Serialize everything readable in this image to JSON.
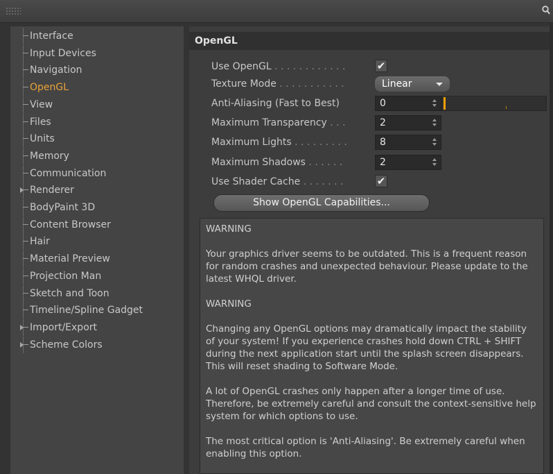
{
  "sidebar": {
    "items": [
      {
        "label": "Interface",
        "active": false,
        "expandable": false
      },
      {
        "label": "Input Devices",
        "active": false,
        "expandable": false
      },
      {
        "label": "Navigation",
        "active": false,
        "expandable": false
      },
      {
        "label": "OpenGL",
        "active": true,
        "expandable": false
      },
      {
        "label": "View",
        "active": false,
        "expandable": false
      },
      {
        "label": "Files",
        "active": false,
        "expandable": false
      },
      {
        "label": "Units",
        "active": false,
        "expandable": false
      },
      {
        "label": "Memory",
        "active": false,
        "expandable": false
      },
      {
        "label": "Communication",
        "active": false,
        "expandable": false
      },
      {
        "label": "Renderer",
        "active": false,
        "expandable": true
      },
      {
        "label": "BodyPaint 3D",
        "active": false,
        "expandable": false
      },
      {
        "label": "Content Browser",
        "active": false,
        "expandable": false
      },
      {
        "label": "Hair",
        "active": false,
        "expandable": false
      },
      {
        "label": "Material Preview",
        "active": false,
        "expandable": false
      },
      {
        "label": "Projection Man",
        "active": false,
        "expandable": false
      },
      {
        "label": "Sketch and Toon",
        "active": false,
        "expandable": false
      },
      {
        "label": "Timeline/Spline Gadget",
        "active": false,
        "expandable": false
      },
      {
        "label": "Import/Export",
        "active": false,
        "expandable": true
      },
      {
        "label": "Scheme Colors",
        "active": false,
        "expandable": true
      }
    ]
  },
  "panel": {
    "title": "OpenGL",
    "use_opengl": {
      "label": "Use OpenGL",
      "dots": " . . . . . . . . . . . .",
      "checked": true,
      "mark": "✔"
    },
    "texture_mode": {
      "label": "Texture Mode",
      "dots": " . . . . . . . . . . .",
      "value": "Linear"
    },
    "anti_aliasing": {
      "label": "Anti-Aliasing (Fast to Best)",
      "value": "0"
    },
    "max_transparency": {
      "label": "Maximum Transparency",
      "dots": " . . .",
      "value": "2"
    },
    "max_lights": {
      "label": "Maximum Lights",
      "dots": " . . . . . . . . .",
      "value": "8"
    },
    "max_shadows": {
      "label": "Maximum Shadows",
      "dots": " . . . . . .",
      "value": "2"
    },
    "shader_cache": {
      "label": "Use Shader Cache",
      "dots": " . . . . . . .",
      "checked": true,
      "mark": "✔"
    },
    "caps_button": "Show OpenGL Capabilities...",
    "warning_paragraphs": [
      "WARNING",
      "Your graphics driver seems to be outdated. This is a frequent reason for random crashes and unexpected behaviour. Please update to the latest WHQL driver.",
      "WARNING",
      "Changing any OpenGL options may dramatically impact the stability of your system! If you experience crashes hold down CTRL + SHIFT during the next application start until the splash screen disappears. This will reset shading to Software Mode.",
      "A lot of OpenGL crashes only happen after a longer time of use. Therefore, be extremely careful and consult the context-sensitive help system for which options to use.",
      "The most critical option is 'Anti-Aliasing'. Be extremely careful when enabling this option."
    ]
  },
  "colors": {
    "accent": "#e8a23a",
    "slider": "#f0a000"
  },
  "icons": {
    "topbar_left": "grip-icon",
    "topbar_right": "search-icon"
  }
}
